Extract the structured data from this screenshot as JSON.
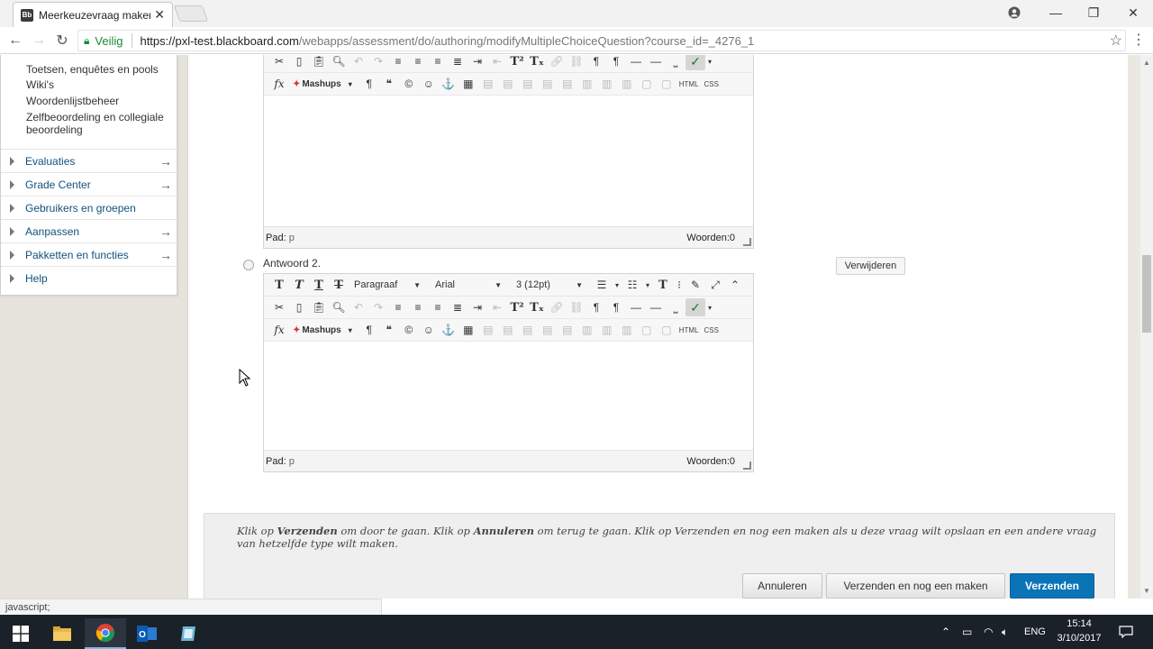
{
  "browser": {
    "tab_title": "Meerkeuzevraag maken/",
    "tab_favicon": "Bb",
    "secure_label": "Veilig",
    "url_host": "https://pxl-test.blackboard.com",
    "url_path": "/webapps/assessment/do/authoring/modifyMultipleChoiceQuestion?course_id=_4276_1",
    "status_text": "javascript;"
  },
  "course_menu": {
    "subitems": [
      "Toetsen, enquêtes en pools",
      "Wiki's",
      "Woordenlijstbeheer",
      "Zelfbeoordeling en collegiale beoordeling"
    ],
    "sections": [
      {
        "label": "Evaluaties",
        "arrow": "→"
      },
      {
        "label": "Grade Center",
        "arrow": "→"
      },
      {
        "label": "Gebruikers en groepen",
        "arrow": ""
      },
      {
        "label": "Aanpassen",
        "arrow": "→"
      },
      {
        "label": "Pakketten en functies",
        "arrow": "→"
      },
      {
        "label": "Help",
        "arrow": ""
      }
    ]
  },
  "editor": {
    "mashups_label": "Mashups",
    "html_label": "HTML",
    "css_label": "CSS",
    "path_label": "Pad:",
    "path_value": "p",
    "words_label": "Woorden:0",
    "paragraph_format": "Paragraaf",
    "font_family": "Arial",
    "font_size": "3 (12pt)"
  },
  "answer2": {
    "label": "Antwoord 2.",
    "remove_button": "Verwijderen"
  },
  "submit": {
    "hint_prefix": "Klik op ",
    "hint_submit": "Verzenden",
    "hint_mid": " om door te gaan. Klik op ",
    "hint_cancel": "Annuleren",
    "hint_suffix": " om terug te gaan. Klik op Verzenden en nog een maken als u deze vraag wilt opslaan en een andere vraag van hetzelfde type wilt maken.",
    "cancel_button": "Annuleren",
    "submit_another_button": "Verzenden en nog een maken",
    "submit_button": "Verzenden"
  },
  "taskbar": {
    "language": "ENG",
    "time": "15:14",
    "date": "3/10/2017"
  },
  "colors": {
    "link_blue": "#12517e",
    "primary_button": "#0b74b7",
    "secure_green": "#1a8a35"
  }
}
